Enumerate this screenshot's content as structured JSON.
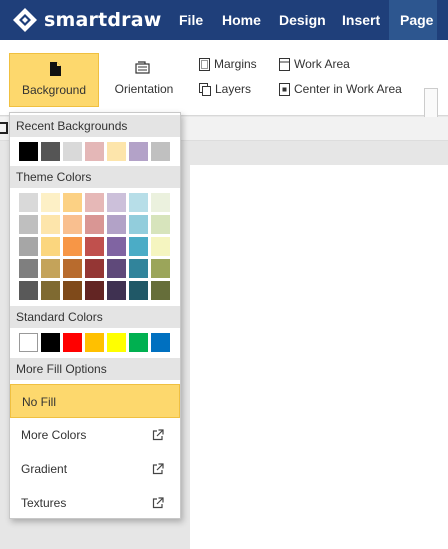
{
  "app": {
    "logo_text": "smartdraw",
    "menu": [
      "File",
      "Home",
      "Design",
      "Insert",
      "Page"
    ],
    "active_menu": "Page",
    "colors": {
      "nav": "#1f3f7a",
      "active_tab": "#2d568f",
      "highlight": "#fdd86d"
    }
  },
  "ribbon": {
    "background_label": "Background",
    "orientation_label": "Orientation",
    "margins_label": "Margins",
    "layers_label": "Layers",
    "work_area_label": "Work Area",
    "center_label": "Center in Work Area"
  },
  "dropdown": {
    "recent_label": "Recent Backgrounds",
    "recent_colors": [
      "#000000",
      "#555555",
      "#d9d9d9",
      "#e4b7b7",
      "#fde5ab",
      "#b3a2c8",
      "#c0c0c0"
    ],
    "theme_label": "Theme Colors",
    "theme_colors": [
      [
        "#d9d9d9",
        "#fdf0c6",
        "#fcd184",
        "#e6b8b7",
        "#ccc0da",
        "#b7dee8",
        "#ebf1de"
      ],
      [
        "#bfbfbf",
        "#fde5ab",
        "#f9bf8f",
        "#d99694",
        "#b2a2c7",
        "#92cddc",
        "#d7e4bc"
      ],
      [
        "#a6a6a6",
        "#fbd67e",
        "#f79646",
        "#c0504d",
        "#8064a2",
        "#4bacc6",
        "#f5f5c0"
      ],
      [
        "#7f7f7f",
        "#c4a35a",
        "#b86b2d",
        "#943634",
        "#5f497a",
        "#31849b",
        "#9ba55a"
      ],
      [
        "#595959",
        "#7f6a31",
        "#7f4a1a",
        "#632523",
        "#3f3151",
        "#205867",
        "#666e3a"
      ]
    ],
    "standard_label": "Standard Colors",
    "standard_colors": [
      "#ffffff",
      "#000000",
      "#ff0000",
      "#ffc000",
      "#ffff00",
      "#00b050",
      "#0070c0"
    ],
    "more_fill_label": "More Fill Options",
    "no_fill_label": "No Fill",
    "more_colors_label": "More Colors",
    "gradient_label": "Gradient",
    "textures_label": "Textures"
  }
}
